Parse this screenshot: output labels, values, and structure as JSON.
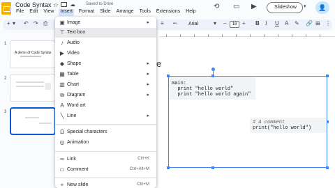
{
  "doc": {
    "title": "Code Syntax",
    "saved": "Saved to Drive"
  },
  "menubar": [
    "File",
    "Edit",
    "View",
    "Insert",
    "Format",
    "Slide",
    "Arrange",
    "Tools",
    "Extensions",
    "Help"
  ],
  "header": {
    "slideshow_label": "Slideshow"
  },
  "toolbar": {
    "font": "Arial",
    "size": "18"
  },
  "filmstrip": {
    "slides": [
      {
        "num": "1",
        "title": "A demo of Code Syntax",
        "selected": false
      },
      {
        "num": "2",
        "title": "",
        "selected": false
      },
      {
        "num": "3",
        "title": "",
        "selected": true
      }
    ]
  },
  "insert_menu": {
    "items": [
      {
        "label": "Image",
        "icon": "image-icon",
        "arrow": true,
        "shortcut": ""
      },
      {
        "label": "Text box",
        "icon": "textbox-icon",
        "arrow": false,
        "shortcut": ""
      },
      {
        "label": "Audio",
        "icon": "audio-icon",
        "arrow": false,
        "shortcut": ""
      },
      {
        "label": "Video",
        "icon": "video-icon",
        "arrow": false,
        "shortcut": ""
      },
      {
        "label": "Shape",
        "icon": "shape-icon",
        "arrow": true,
        "shortcut": ""
      },
      {
        "label": "Table",
        "icon": "table-icon",
        "arrow": true,
        "shortcut": ""
      },
      {
        "label": "Chart",
        "icon": "chart-icon",
        "arrow": true,
        "shortcut": ""
      },
      {
        "label": "Diagram",
        "icon": "diagram-icon",
        "arrow": true,
        "shortcut": ""
      },
      {
        "label": "Word art",
        "icon": "wordart-icon",
        "arrow": false,
        "shortcut": ""
      },
      {
        "label": "Line",
        "icon": "line-icon",
        "arrow": true,
        "shortcut": ""
      },
      {
        "label": "Special characters",
        "icon": "omega-icon",
        "arrow": false,
        "shortcut": ""
      },
      {
        "label": "Animation",
        "icon": "animation-icon",
        "arrow": false,
        "shortcut": ""
      },
      {
        "label": "Link",
        "icon": "link-icon",
        "arrow": false,
        "shortcut": "Ctrl+K"
      },
      {
        "label": "Comment",
        "icon": "comment-icon",
        "arrow": false,
        "shortcut": "Ctrl+Alt+M"
      },
      {
        "label": "New slide",
        "icon": "plus-icon",
        "arrow": false,
        "shortcut": "Ctrl+M"
      }
    ]
  },
  "slide": {
    "title_fragment": "e",
    "code1": [
      "main:",
      "  print \"hello world\"",
      "  print \"hello world again\""
    ],
    "code2": [
      "# A comment",
      "print(\"hello world\")"
    ]
  }
}
